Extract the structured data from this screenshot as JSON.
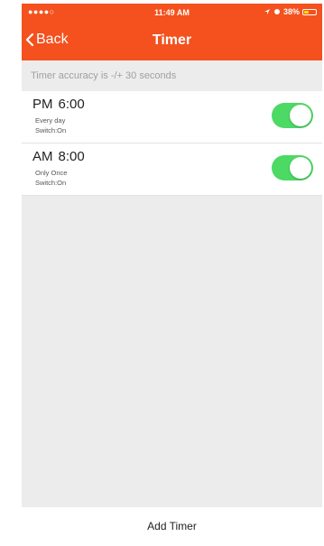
{
  "status_bar": {
    "signal": "●●●●○",
    "time": "11:49 AM",
    "battery_pct": "38%",
    "battery_level": 0.38
  },
  "nav": {
    "back_label": "Back",
    "title": "Timer"
  },
  "notice": "Timer accuracy is -/+ 30 seconds",
  "timers": [
    {
      "ampm": "PM",
      "time": "6:00",
      "repeat": "Every day",
      "switch_text": "Switch:On",
      "enabled": true
    },
    {
      "ampm": "AM",
      "time": "8:00",
      "repeat": "Only Once",
      "switch_text": "Switch:On",
      "enabled": true
    }
  ],
  "footer": {
    "add_label": "Add Timer"
  },
  "colors": {
    "header": "#f4511e",
    "toggle_on": "#4cd964",
    "background": "#ececec"
  }
}
